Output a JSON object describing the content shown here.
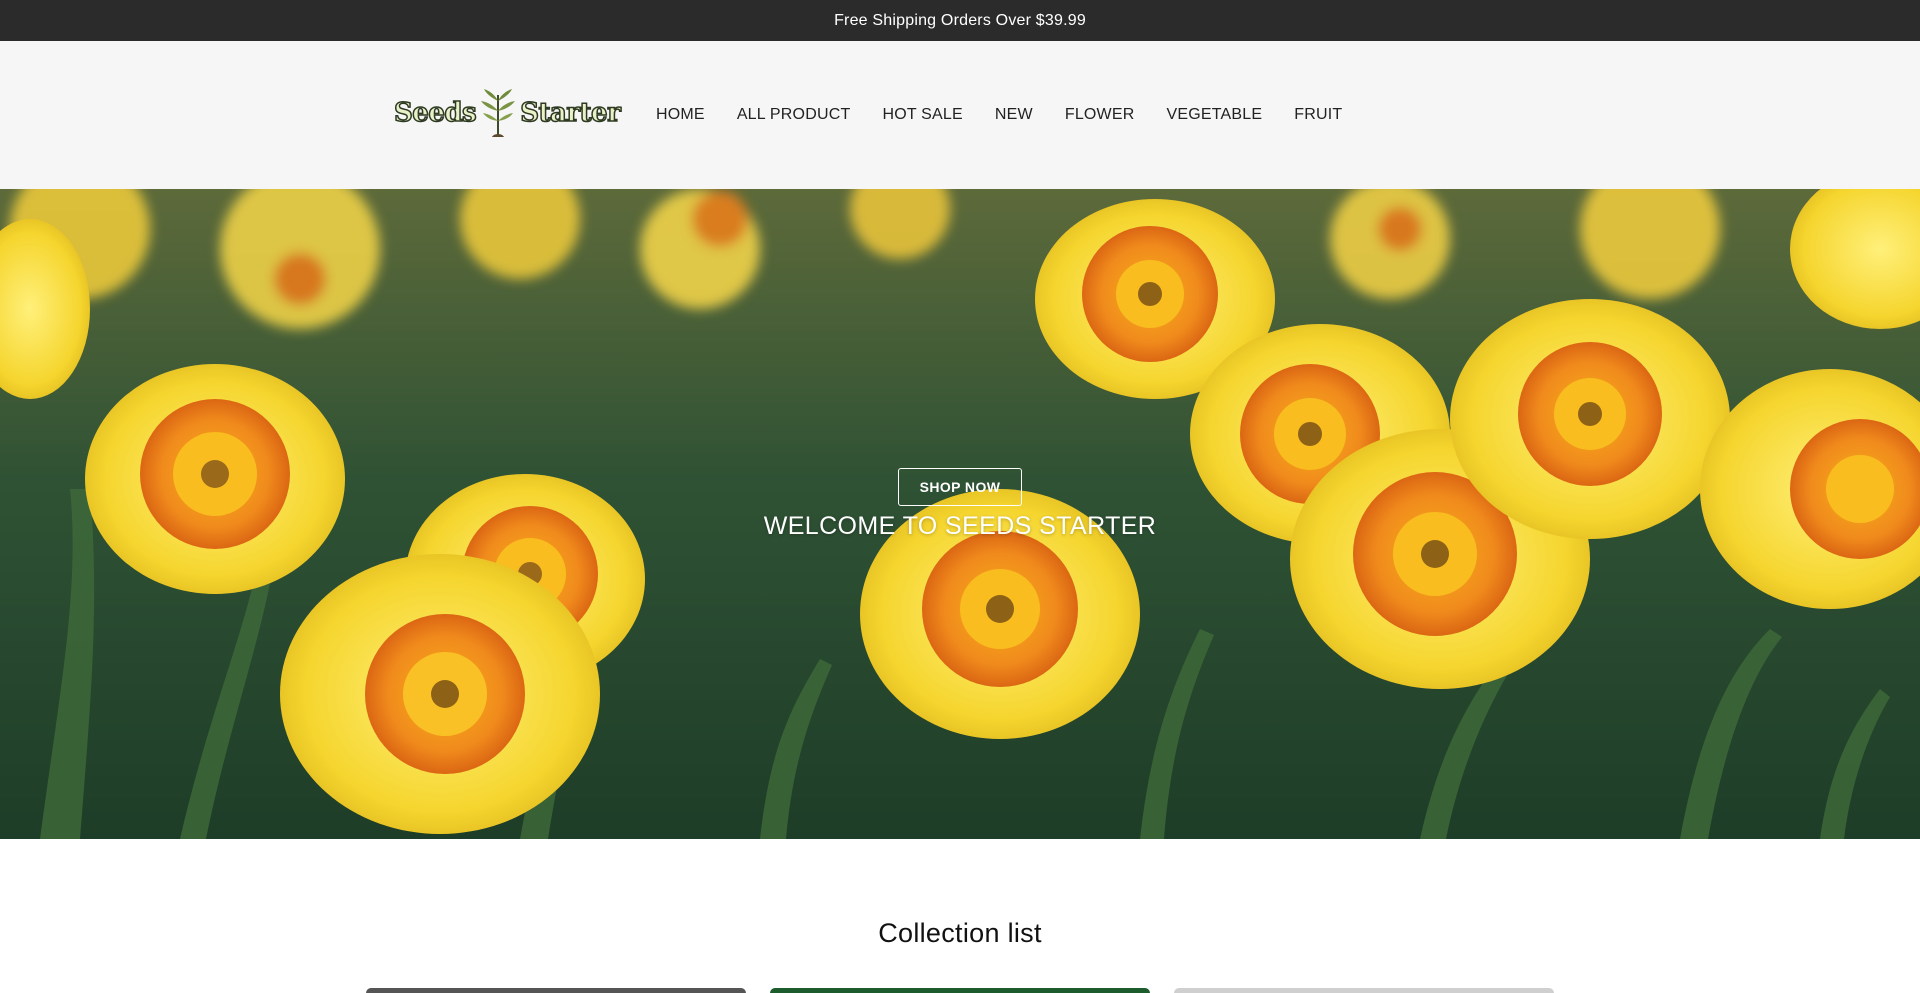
{
  "announcement": {
    "text": "Free Shipping Orders Over $39.99"
  },
  "header": {
    "logo": {
      "text_left": "Seeds",
      "text_right": "Starter"
    },
    "nav": [
      {
        "label": "HOME"
      },
      {
        "label": "ALL PRODUCT"
      },
      {
        "label": "HOT SALE"
      },
      {
        "label": "NEW"
      },
      {
        "label": "FLOWER"
      },
      {
        "label": "VEGETABLE"
      },
      {
        "label": "FRUIT"
      }
    ]
  },
  "hero": {
    "button_label": "SHOP NOW",
    "heading": "WELCOME TO SEEDS STARTER",
    "image_subject": "daffodil-field-photo"
  },
  "collection": {
    "title": "Collection list",
    "cards": [
      {
        "name": "collection-card-1"
      },
      {
        "name": "collection-card-2"
      },
      {
        "name": "collection-card-3"
      }
    ]
  },
  "colors": {
    "announcement_bg": "#2b2b2b",
    "header_bg": "#f6f6f6",
    "hero_foliage": "#2a4a30",
    "petal_yellow": "#f6dc3a",
    "corona_orange": "#e6761a"
  }
}
